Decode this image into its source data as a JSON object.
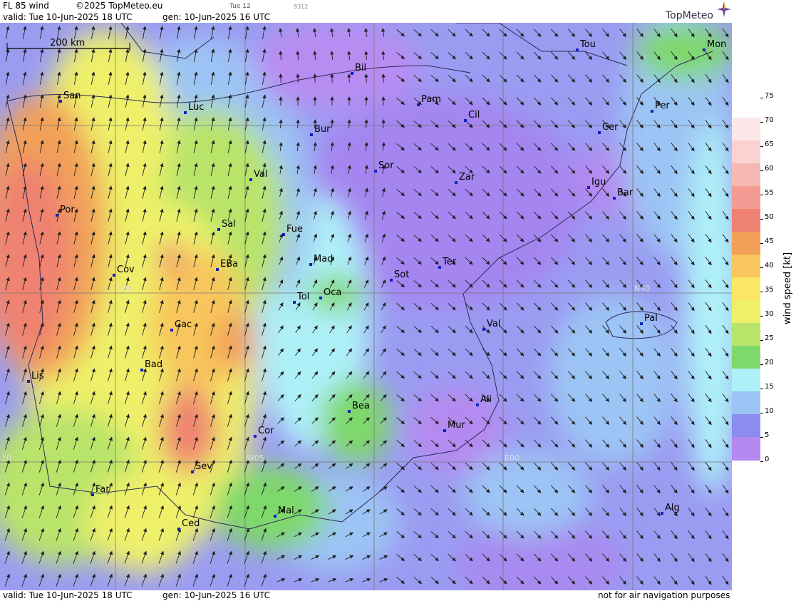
{
  "header": {
    "title": "FL 85 wind",
    "copyright": "©2025 TopMeteo.eu",
    "valid": "valid:  Tue  10-Jun-2025  18 UTC",
    "gen": "gen: 10-Jun-2025 16 UTC",
    "run": "Tue 12",
    "code": "9312",
    "logo": "TopMeteo"
  },
  "footer": {
    "valid": "valid:  Tue  10-Jun-2025  18 UTC",
    "gen": "gen: 10-Jun-2025 16 UTC",
    "notice": "not for air navigation purposes"
  },
  "map": {
    "scale_label": "200 km",
    "grid_labels": [
      "N40",
      "N40",
      "W05",
      "E00",
      "10"
    ],
    "cities": [
      "San",
      "Luc",
      "Val",
      "Sal",
      "Por",
      "Cov",
      "EBa",
      "Fue",
      "Mad",
      "Tol",
      "Oca",
      "Sot",
      "Ter",
      "Val",
      "Cac",
      "Bad",
      "Lis",
      "Cor",
      "Bea",
      "Ali",
      "Mur",
      "Sev",
      "Far",
      "Mal",
      "Ced",
      "Bil",
      "Pam",
      "Cil",
      "Bur",
      "Sor",
      "Zar",
      "Tou",
      "Mon",
      "Per",
      "Cer",
      "Igu",
      "Bar",
      "Pal",
      "Alg"
    ]
  },
  "legend": {
    "unit": "wind speed [kt]",
    "ticks": [
      "75",
      "70",
      "65",
      "60",
      "55",
      "50",
      "45",
      "40",
      "35",
      "30",
      "25",
      "20",
      "15",
      "10",
      "5",
      "0"
    ],
    "colors": [
      "#ffffff",
      "#fce8e8",
      "#fad2d2",
      "#f6b8b4",
      "#f39c94",
      "#ef8270",
      "#f2a058",
      "#f8c65c",
      "#fbe666",
      "#eef06a",
      "#b8e46a",
      "#7fd86a",
      "#aef0f8",
      "#9cc4f4",
      "#8a8cf0",
      "#b58af0"
    ]
  }
}
